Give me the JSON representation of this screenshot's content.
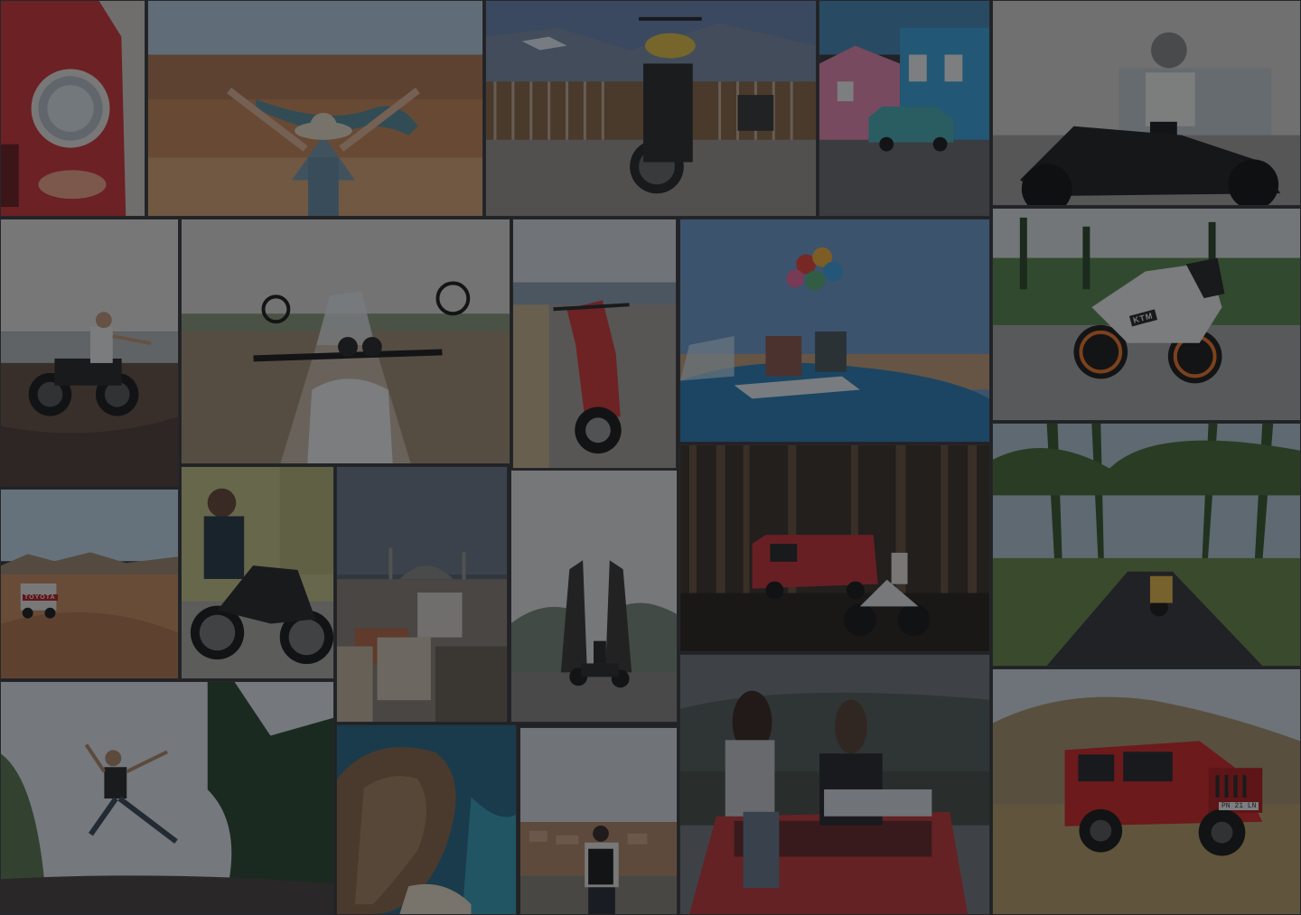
{
  "page": {
    "title": ""
  },
  "collage": {
    "tiles": [
      {
        "id": "t1",
        "subject": "red classic car headlight"
      },
      {
        "id": "t2",
        "subject": "woman in hat overlooking canyon"
      },
      {
        "id": "t3",
        "subject": "motorcycle by wooden fence and mountains"
      },
      {
        "id": "t4",
        "subject": "teal hatchback by colorful houses"
      },
      {
        "id": "t5",
        "subject": "woman in helmet on black motorcycle"
      },
      {
        "id": "t6",
        "subject": "rider on motorcycle at beach"
      },
      {
        "id": "t7",
        "subject": "motorcycle handlebars on dirt road"
      },
      {
        "id": "t8",
        "subject": "red scooter by the sea"
      },
      {
        "id": "t9",
        "subject": "balloons above convertible"
      },
      {
        "id": "t10",
        "subject": "white KTM sport motorcycle"
      },
      {
        "id": "t11",
        "subject": "truck in desert"
      },
      {
        "id": "t12",
        "subject": "bearded man on motorcycle"
      },
      {
        "id": "t13",
        "subject": "city with mosque"
      },
      {
        "id": "t14",
        "subject": "temple gate and motorcycle"
      },
      {
        "id": "t15",
        "subject": "red van and motorcycle in forest"
      },
      {
        "id": "t16",
        "subject": "scooter on palm-lined road"
      },
      {
        "id": "t17",
        "subject": "person jumping on cliff"
      },
      {
        "id": "t18",
        "subject": "coastal cliff and sea"
      },
      {
        "id": "t19",
        "subject": "backpacker overlooking town"
      },
      {
        "id": "t20",
        "subject": "two women on car roof"
      },
      {
        "id": "t21",
        "subject": "red jeep on grass hills"
      }
    ],
    "badges": {
      "toyota": "TOYOTA",
      "ktm": "KTM"
    },
    "plates": {
      "jeep": "PN 21 LN"
    }
  }
}
